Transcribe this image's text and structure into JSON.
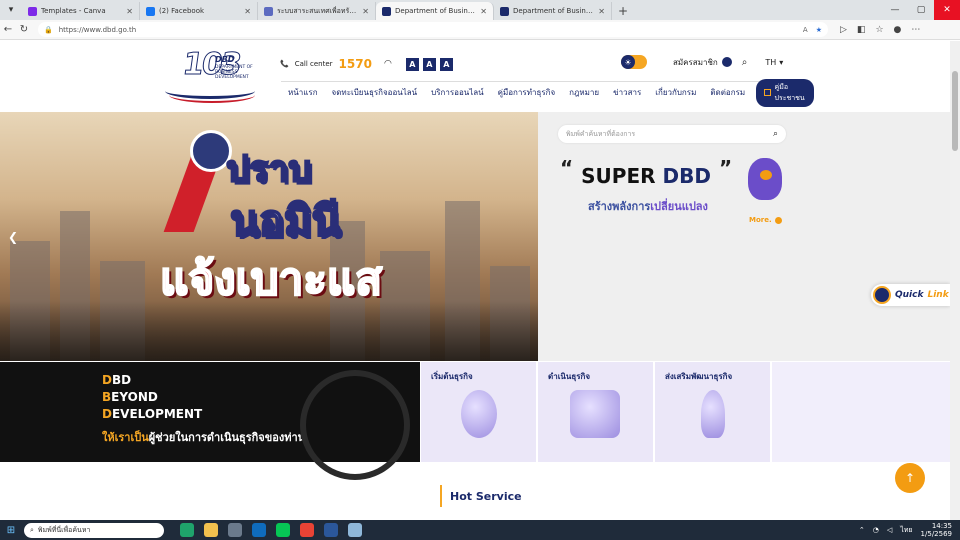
{
  "browser": {
    "tabs": [
      {
        "label": "Templates - Canva",
        "color": "#7d2ae8",
        "active": false
      },
      {
        "label": "(2) Facebook",
        "color": "#1877f2",
        "active": false
      },
      {
        "label": "ระบบสาระสนเทศเพื่อทรัพย์สินทางปัญญา",
        "color": "#5c6bc0",
        "active": false
      },
      {
        "label": "Department of Business Developme",
        "color": "#1b2a6b",
        "active": true
      },
      {
        "label": "Department of Business Developme",
        "color": "#1b2a6b",
        "active": false
      }
    ],
    "url": "https://www.dbd.go.th"
  },
  "header": {
    "logo_number": "103",
    "logo_abbr": "DBD",
    "logo_dept": "DEPARTMENT OF BUSINESS DEVELOPMENT",
    "call_center_label": "Call center",
    "call_center_number": "1570",
    "font_sizes": [
      "A",
      "A",
      "A"
    ],
    "member_label": "สมัครสมาชิก",
    "lang": "TH"
  },
  "nav": {
    "items": [
      "หน้าแรก",
      "จดทะเบียนธุรกิจออนไลน์",
      "บริการออนไลน์",
      "คู่มือการทำธุรกิจ",
      "กฎหมาย",
      "ข่าวสาร",
      "เกี่ยวกับกรม",
      "ติดต่อกรม"
    ],
    "manual_label": "คู่มือประชาชน"
  },
  "hero": {
    "line1": "ปราบ",
    "line2": "นอมินี",
    "line3": "แจ้งเบาะแส"
  },
  "panel": {
    "search_placeholder": "พิมพ์คำค้นหาที่ต้องการ",
    "super_prefix": "SUPER",
    "super_brand": "DBD",
    "slogan_a": "สร้างพลังการ",
    "slogan_b": "เปลี่ยนแปลง",
    "more": "More."
  },
  "quicklink": {
    "a": "Quick",
    "b": "Link"
  },
  "beyond": {
    "words": [
      {
        "first": "D",
        "rest": "BD"
      },
      {
        "first": "B",
        "rest": "EYOND"
      },
      {
        "first": "D",
        "rest": "EVELOPMENT"
      }
    ],
    "tag_a": "ให้เราเป็น",
    "tag_b": "ผู้ช่วยในการดำเนินธุรกิจของท่าน"
  },
  "cards": [
    "เริ่มต้นธุรกิจ",
    "ดำเนินธุรกิจ",
    "ส่งเสริมพัฒนาธุรกิจ"
  ],
  "hot_service": "Hot Service",
  "taskbar": {
    "search_placeholder": "พิมพ์ที่นี่เพื่อค้นหา",
    "time": "14:35",
    "date": "1/5/2569",
    "lang": "ไทย"
  }
}
